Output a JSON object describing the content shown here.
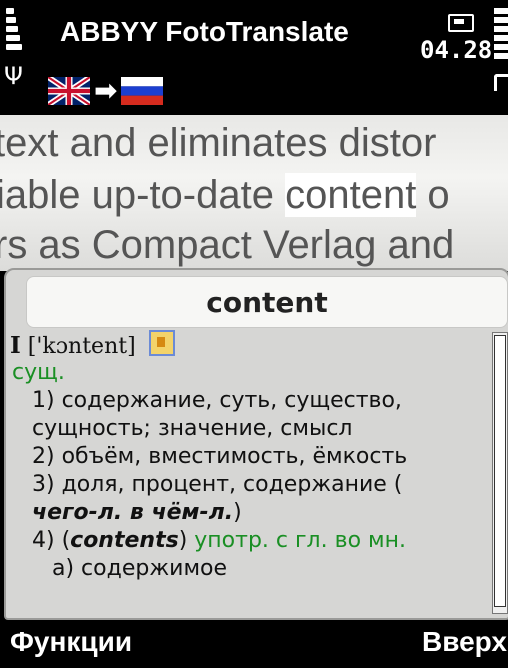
{
  "status_bar": {
    "app_title": "ABBYY FotoTranslate",
    "clock": "04.28",
    "signal_icon": "signal-bars-icon",
    "battery_icon": "battery-icon"
  },
  "languages": {
    "source": "English (UK flag)",
    "target": "Russian (flag)",
    "arrow": "➡"
  },
  "camera_text": {
    "line0": "text and eliminates distor",
    "line1_pre": "iable up-to-date ",
    "line1_hl": "content",
    "line1_post": " o",
    "line2": "rs as Compact Verlag and"
  },
  "dictionary": {
    "headword": "content",
    "roman": "I",
    "transcription": "['kɔntent]",
    "pos": "сущ.",
    "s1a": "1) содержание, суть, существо,",
    "s1b": "сущность; значение, смысл",
    "s2": "2) объём, вместимость, ёмкость",
    "s3a": "3) доля, процент, содержание (",
    "s3b": "чего-л. в чём-л.",
    "s3b_close": ")",
    "s4_num": "4) (",
    "s4_word": "contents",
    "s4_close": ")",
    "s4_note": "употр. с гл. во мн.",
    "s4a": "а) содержимое"
  },
  "softkeys": {
    "left": "Функции",
    "right": "Вверх"
  },
  "colors": {
    "green": "#1a8f24",
    "panel_bg": "#d6d6d4"
  }
}
